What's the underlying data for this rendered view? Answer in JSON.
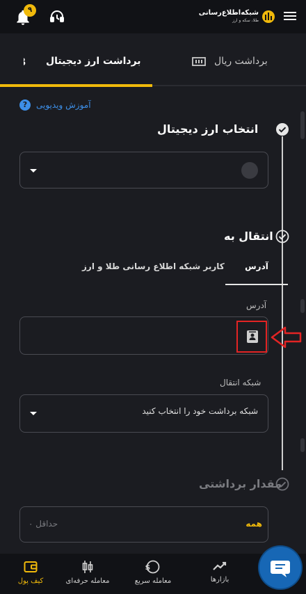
{
  "header": {
    "notification_count": "۹",
    "logo_name": "شبکه‌اطلاع‌رسانی",
    "logo_sub": "طلا، سکه و ارز"
  },
  "tabs": {
    "crypto_label": "برداشت ارز دیجیتال",
    "rial_label": "برداشت ریال",
    "active": "crypto"
  },
  "video_link": "آموزش ویدیویی",
  "step1": {
    "title": "انتخاب ارز دیجیتال"
  },
  "step2": {
    "title": "انتقال به",
    "subtab_address": "آدرس",
    "subtab_user": "کاربر شبکه اطلاع رسانی طلا و ارز",
    "address_label": "آدرس",
    "address_value": "",
    "network_label": "شبکه انتقال",
    "network_placeholder": "شبکه برداشت خود را انتخاب کنید"
  },
  "step3": {
    "title": "مقدار برداشتی",
    "all_label": "همه",
    "min_placeholder": "حداقل ۰"
  },
  "bottom_nav": {
    "wallet": "کیف پول",
    "pro_trade": "معامله حرفه‌ای",
    "quick_trade": "معامله سریع",
    "markets": "بازارها"
  },
  "colors": {
    "accent": "#f0b90b",
    "link": "#3d8fe8",
    "highlight": "#e32424",
    "chat": "#1767b5"
  }
}
